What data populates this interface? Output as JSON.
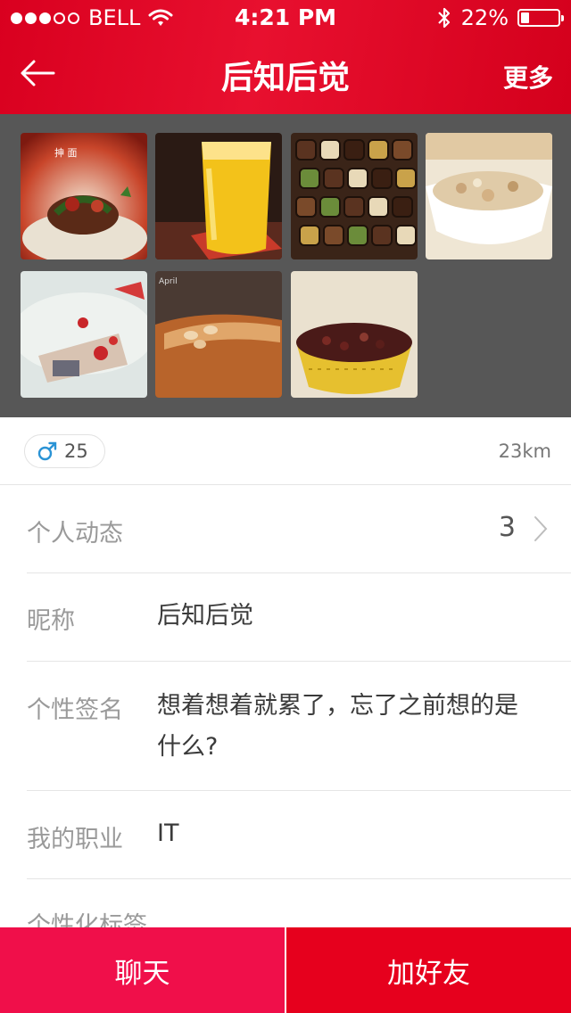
{
  "status_bar": {
    "carrier": "BELL",
    "time": "4:21 PM",
    "battery": "22%",
    "battery_level": 0.22,
    "signal_bars": 3,
    "signal_total": 5
  },
  "nav": {
    "title": "后知后觉",
    "more_label": "更多"
  },
  "gallery": {
    "photos": [
      {
        "name": "noodle-dish",
        "caption": "抻 面"
      },
      {
        "name": "orange-juice",
        "caption": ""
      },
      {
        "name": "chocolate-box",
        "caption": ""
      },
      {
        "name": "oat-porridge",
        "caption": ""
      },
      {
        "name": "pork-rib-soup",
        "caption": ""
      },
      {
        "name": "almond-cake",
        "caption": "April"
      },
      {
        "name": "bean-congee",
        "caption": ""
      }
    ]
  },
  "profile": {
    "gender_icon": "male-icon",
    "age": "25",
    "distance": "23km",
    "activity_label": "个人动态",
    "activity_count": "3",
    "nickname_label": "昵称",
    "nickname": "后知后觉",
    "signature_label": "个性签名",
    "signature": "想着想着就累了，忘了之前想的是什么?",
    "job_label": "我的职业",
    "job": "IT",
    "tags_label": "个性化标签"
  },
  "actions": {
    "chat_label": "聊天",
    "add_friend_label": "加好友"
  },
  "colors": {
    "brand_red": "#e6001d",
    "chat_pink": "#f00f4a",
    "male_blue": "#2a93d5"
  }
}
